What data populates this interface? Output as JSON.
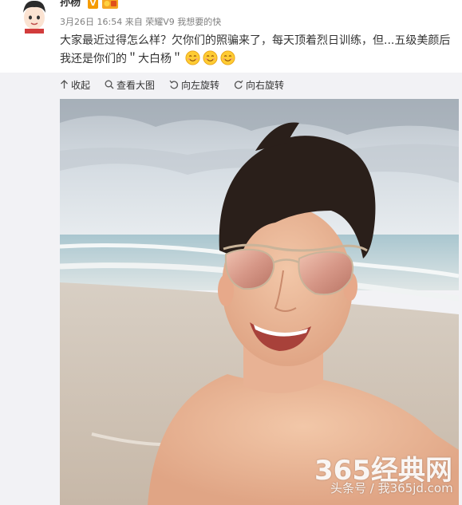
{
  "post": {
    "author": "孙杨",
    "verified_badge": "V",
    "meta": {
      "date_time": "3月26日 16:54",
      "source_prefix": "来自",
      "source": "荣耀V9 我想要的快"
    },
    "text_line1": "大家最近过得怎么样？欠你们的照骗来了，每天顶着烈日训练，但...五级美颜后",
    "text_line2": "我还是你们的＂大白杨＂",
    "emoji_count": 3,
    "emoji_name": "smile-emoji"
  },
  "toolbar": {
    "collapse_label": "收起",
    "view_large_label": "查看大图",
    "rotate_left_label": "向左旋转",
    "rotate_right_label": "向右旋转"
  },
  "watermark": {
    "main": "365经典网",
    "sub": "头条号 / 我365jd.com"
  },
  "colors": {
    "text": "#333333",
    "meta": "#808080",
    "badge": "#f59b00",
    "media_bg": "#f2f2f5"
  }
}
